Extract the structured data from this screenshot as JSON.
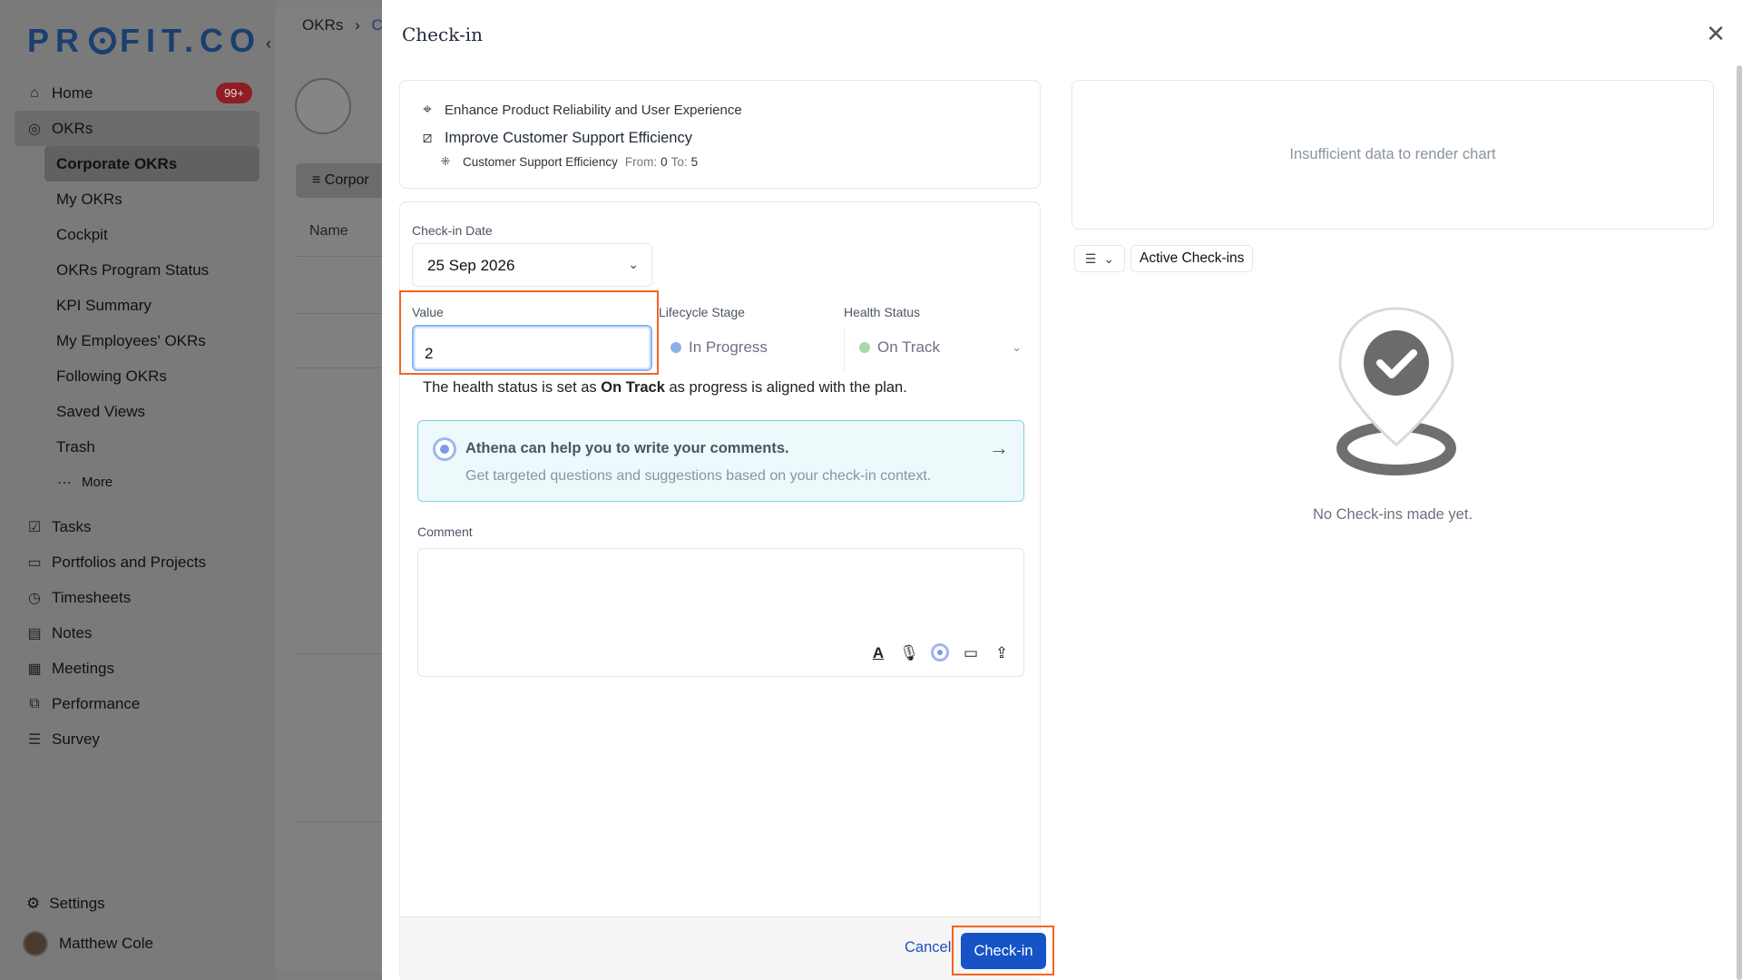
{
  "sidebar": {
    "logo": "PRFIT.CO",
    "logo_full": "PROFIT.CO",
    "nav": [
      {
        "label": "Home",
        "icon": "home-icon",
        "badge": "99+"
      },
      {
        "label": "OKRs",
        "icon": "target-icon"
      }
    ],
    "okr_sub": [
      {
        "label": "Corporate OKRs"
      },
      {
        "label": "My OKRs"
      },
      {
        "label": "Cockpit"
      },
      {
        "label": "OKRs Program Status"
      },
      {
        "label": "KPI Summary"
      },
      {
        "label": "My Employees' OKRs"
      },
      {
        "label": "Following OKRs"
      },
      {
        "label": "Saved Views"
      },
      {
        "label": "Trash"
      },
      {
        "label": "More"
      }
    ],
    "nav2": [
      {
        "label": "Tasks",
        "icon": "clipboard-icon"
      },
      {
        "label": "Portfolios and Projects",
        "icon": "briefcase-icon"
      },
      {
        "label": "Timesheets",
        "icon": "stopwatch-icon"
      },
      {
        "label": "Notes",
        "icon": "notepad-icon"
      },
      {
        "label": "Meetings",
        "icon": "calendar-icon"
      },
      {
        "label": "Performance",
        "icon": "chart-icon"
      },
      {
        "label": "Survey",
        "icon": "survey-icon"
      }
    ],
    "settings": "Settings",
    "user": "Matthew Cole"
  },
  "background": {
    "breadcrumb_root": "OKRs",
    "breadcrumb_sep": "›",
    "breadcrumb_current": "C",
    "tab": "Corpor",
    "name_col": "Name"
  },
  "modal": {
    "title": "Check-in",
    "objective": "Enhance Product Reliability and User Experience",
    "key_result": "Improve Customer Support Efficiency",
    "kpi_name": "Customer Support Efficiency",
    "from_label": "From:",
    "from_value": "0",
    "to_label": "To:",
    "to_value": "5",
    "checkin_date_label": "Check-in Date",
    "checkin_date": "25 Sep 2026",
    "value_label": "Value",
    "value": "2",
    "lifecycle_label": "Lifecycle Stage",
    "lifecycle_value": "In Progress",
    "health_label": "Health Status",
    "health_value": "On Track",
    "status_note_prefix": "The health status is set as",
    "status_note_bold": "On Track",
    "status_note_suffix": "as progress is aligned with the plan.",
    "athena_title": "Athena can help you to write your comments.",
    "athena_sub": "Get targeted questions and suggestions based on your check-in context.",
    "comment_label": "Comment",
    "cancel": "Cancel",
    "submit": "Check-in",
    "chart_empty": "Insufficient data to render chart",
    "filter_active": "Active Check-ins",
    "empty_state": "No Check-ins made yet."
  },
  "colors": {
    "primary": "#1553c7",
    "highlight": "#f26522",
    "in_progress_dot": "#8ab0e8",
    "on_track_dot": "#a6d9a6",
    "badge": "#8f1d23"
  }
}
